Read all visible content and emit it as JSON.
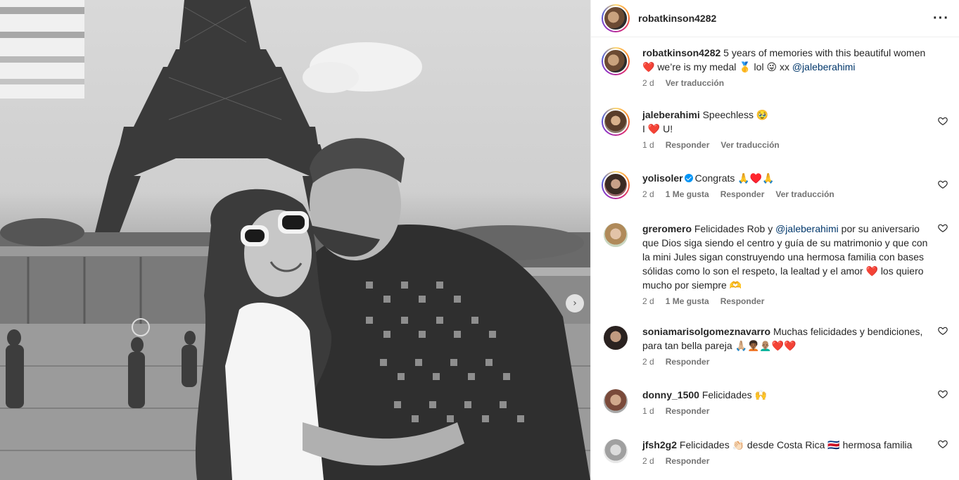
{
  "post": {
    "username": "robatkinson4282",
    "more_icon": "more-horizontal-icon"
  },
  "caption": {
    "username": "robatkinson4282",
    "text_before": " 5 years of memories with this beautiful women ❤️ we’re is my medal 🥇 lol 😜 xx ",
    "mention": "@jaleberahimi",
    "time": "2 d",
    "translate": "Ver traducción"
  },
  "comments": [
    {
      "username": "jaleberahimi",
      "text": " Speechless 🥹",
      "text2": "I ❤️ U!",
      "time": "1 d",
      "reply": "Responder",
      "translate": "Ver traducción"
    },
    {
      "username": "yolisoler",
      "verified": true,
      "text": "Congrats 🙏♥️🙏",
      "time": "2 d",
      "likes": "1 Me gusta",
      "reply": "Responder",
      "translate": "Ver traducción"
    },
    {
      "username": "greromero",
      "text_before": " Felicidades Rob y ",
      "mention": "@jaleberahimi",
      "text_after": " por su aniversario que Dios siga siendo el centro y guía de su matrimonio y que con la mini Jules sigan construyendo una hermosa familia con bases sólidas como lo son el respeto, la lealtad y el amor ❤️ los quiero mucho por siempre 🫶",
      "time": "2 d",
      "likes": "1 Me gusta",
      "reply": "Responder"
    },
    {
      "username": "soniamarisolgomeznavarro",
      "text": " Muchas felicidades y bendiciones, para tan bella pareja 🙏🏼🧑🏾‍🦱👨🏽‍🦲❤️❤️",
      "time": "2 d",
      "reply": "Responder"
    },
    {
      "username": "donny_1500",
      "text": " Felicidades 🙌",
      "time": "1 d",
      "reply": "Responder"
    },
    {
      "username": "jfsh2g2",
      "text": " Felicidades 👏🏻 desde Costa Rica 🇨🇷 hermosa familia",
      "time": "2 d",
      "reply": "Responder"
    }
  ],
  "colors": {
    "text": "#262626",
    "muted": "#737373",
    "link": "#00376b",
    "heart": "#ed4956",
    "verified": "#0095f6"
  }
}
